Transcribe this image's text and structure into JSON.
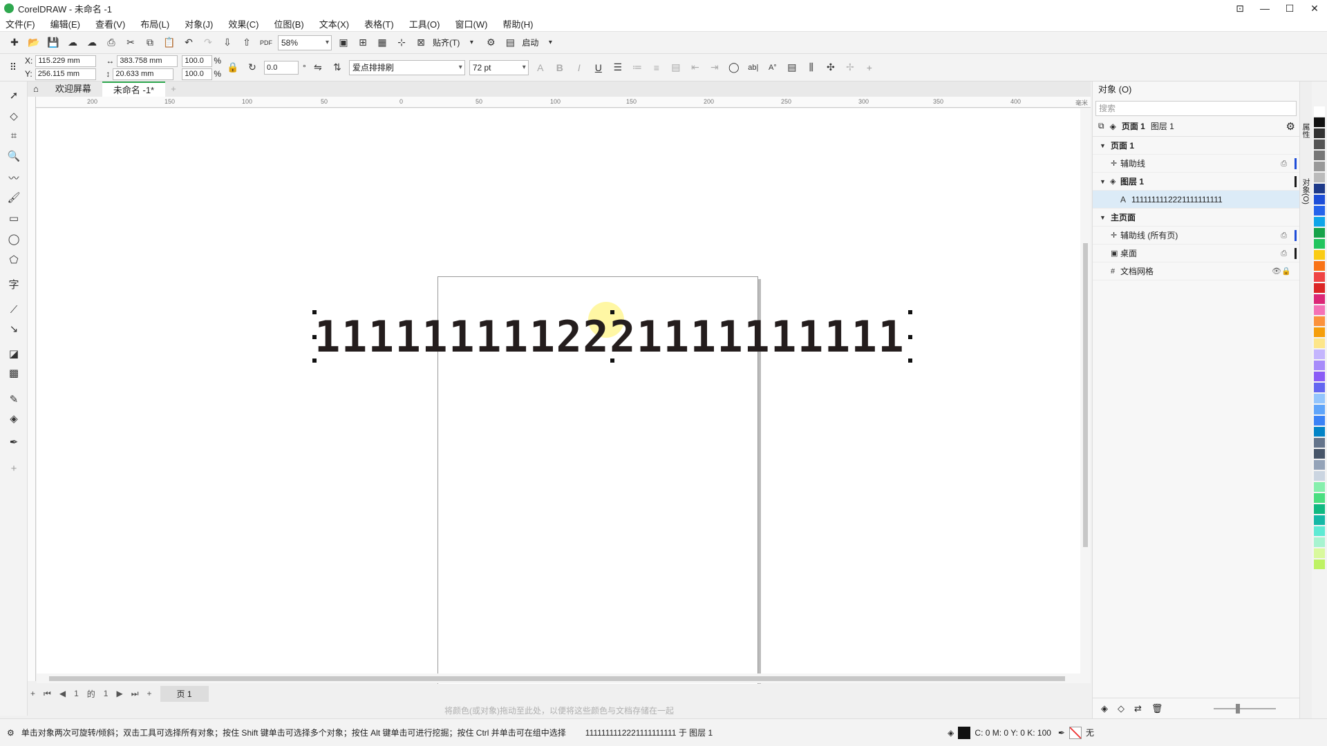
{
  "window": {
    "title": "CorelDRAW - 未命名 -1",
    "controls": [
      "⊡",
      "—",
      "☐",
      "✕"
    ]
  },
  "menu": [
    "文件(F)",
    "编辑(E)",
    "查看(V)",
    "布局(L)",
    "对象(J)",
    "效果(C)",
    "位图(B)",
    "文本(X)",
    "表格(T)",
    "工具(O)",
    "窗口(W)",
    "帮助(H)"
  ],
  "toolbar1": {
    "zoom": "58%",
    "snap_label": "贴齐(T)",
    "launch_label": "启动",
    "pdf_label": "PDF"
  },
  "props": {
    "x_label": "X:",
    "x": "115.229 mm",
    "y_label": "Y:",
    "y": "256.115 mm",
    "w": "383.758 mm",
    "h": "20.633 mm",
    "scale_x": "100.0",
    "scale_y": "100.0",
    "pct": "%",
    "rotation": "0.0",
    "deg": "°",
    "font": "爱点排排刷",
    "font_size": "72 pt",
    "bold": "B",
    "italic": "I",
    "underline": "U",
    "abl": "ab|",
    "ao": "A°"
  },
  "doc_tabs": [
    "欢迎屏幕",
    "未命名 -1*"
  ],
  "ruler": {
    "h_ticks": [
      "200",
      "150",
      "100",
      "50",
      "0",
      "50",
      "100",
      "150",
      "200",
      "250",
      "300",
      "350",
      "400"
    ],
    "unit": "毫米"
  },
  "canvas": {
    "text": "1111111112221111111111"
  },
  "pages": {
    "current": "1",
    "of": "的",
    "total": "1",
    "page_tab": "页 1"
  },
  "color_hint": "将颜色(或对象)拖动至此处，以便将这些颜色与文档存储在一起",
  "status": {
    "hint": "单击对象两次可旋转/倾斜；双击工具可选择所有对象；按住 Shift 键单击可选择多个对象；按住 Alt 键单击可进行挖掘；按住 Ctrl 并单击可在组中选择",
    "object": "1111111112221111111111 于 图层 1",
    "fill_color": "C: 0 M: 0 Y: 0 K: 100",
    "outline": "无"
  },
  "objects_panel": {
    "title": "对象 (O)",
    "search_placeholder": "搜索",
    "crumb_page": "页面 1",
    "crumb_layer": "图层 1",
    "tree": [
      {
        "label": "页面 1",
        "level": 0,
        "bold": true
      },
      {
        "label": "辅助线",
        "level": 1
      },
      {
        "label": "图层 1",
        "level": 1,
        "bold": true
      },
      {
        "label": "1111111112221111111111",
        "level": 2,
        "selected": true
      },
      {
        "label": "主页面",
        "level": 0,
        "bold": true
      },
      {
        "label": "辅助线 (所有页)",
        "level": 1
      },
      {
        "label": "桌面",
        "level": 1
      },
      {
        "label": "文档网格",
        "level": 1
      }
    ]
  },
  "side_tabs": [
    "属性",
    "对象(O)"
  ],
  "palette": [
    "#ffffff",
    "#111111",
    "#333333",
    "#555555",
    "#777777",
    "#999999",
    "#bbbbbb",
    "#1e3a8a",
    "#1d4ed8",
    "#2563eb",
    "#0ea5e9",
    "#16a34a",
    "#22c55e",
    "#facc15",
    "#f97316",
    "#ef4444",
    "#dc2626",
    "#db2777",
    "#f472b6",
    "#fb923c",
    "#f59e0b",
    "#fde68a",
    "#c4b5fd",
    "#a78bfa",
    "#8b5cf6",
    "#6366f1",
    "#93c5fd",
    "#60a5fa",
    "#3b82f6",
    "#0284c7",
    "#64748b",
    "#475569",
    "#94a3b8",
    "#cbd5e1",
    "#86efac",
    "#4ade80",
    "#10b981",
    "#14b8a6",
    "#5eead4",
    "#a7f3d0",
    "#d9f99d",
    "#bef264"
  ],
  "accent": "#2fa84f"
}
